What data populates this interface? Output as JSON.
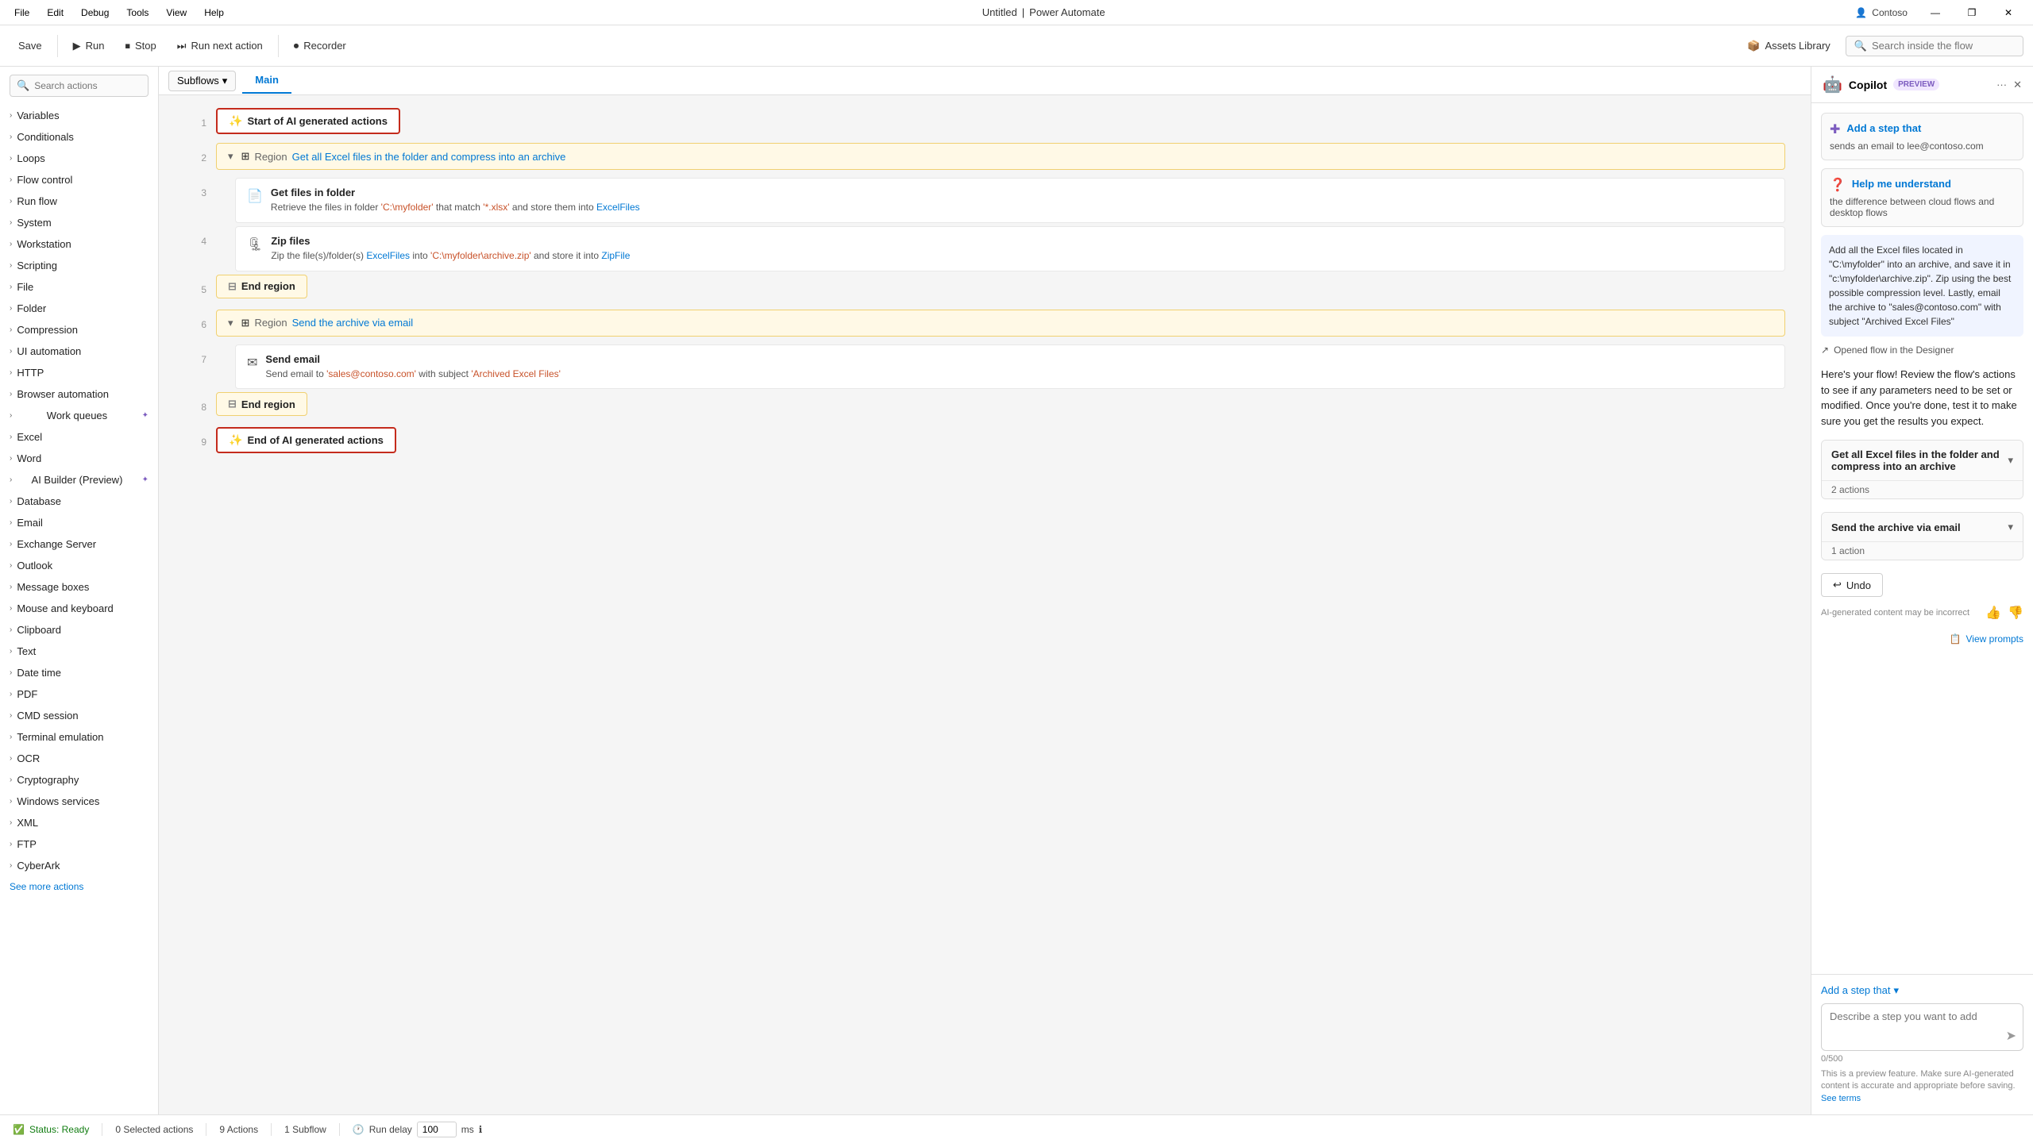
{
  "titleBar": {
    "menus": [
      "File",
      "Edit",
      "Debug",
      "Tools",
      "View",
      "Help"
    ],
    "appName": "Untitled",
    "appSuite": "Power Automate",
    "company": "Contoso",
    "winControls": [
      "—",
      "❐",
      "✕"
    ]
  },
  "toolbar": {
    "save": "Save",
    "run": "Run",
    "stop": "Stop",
    "runNextAction": "Run next action",
    "recorder": "Recorder",
    "assetsLibrary": "Assets Library",
    "searchInside": "Search inside the flow"
  },
  "sidebar": {
    "searchPlaceholder": "Search actions",
    "items": [
      {
        "label": "Variables",
        "hasBadge": false
      },
      {
        "label": "Conditionals",
        "hasBadge": false
      },
      {
        "label": "Loops",
        "hasBadge": false
      },
      {
        "label": "Flow control",
        "hasBadge": false
      },
      {
        "label": "Run flow",
        "hasBadge": false
      },
      {
        "label": "System",
        "hasBadge": false
      },
      {
        "label": "Workstation",
        "hasBadge": false
      },
      {
        "label": "Scripting",
        "hasBadge": false
      },
      {
        "label": "File",
        "hasBadge": false
      },
      {
        "label": "Folder",
        "hasBadge": false
      },
      {
        "label": "Compression",
        "hasBadge": false
      },
      {
        "label": "UI automation",
        "hasBadge": false
      },
      {
        "label": "HTTP",
        "hasBadge": false
      },
      {
        "label": "Browser automation",
        "hasBadge": false
      },
      {
        "label": "Work queues",
        "hasBadge": true
      },
      {
        "label": "Excel",
        "hasBadge": false
      },
      {
        "label": "Word",
        "hasBadge": false
      },
      {
        "label": "AI Builder (Preview)",
        "hasBadge": true
      },
      {
        "label": "Database",
        "hasBadge": false
      },
      {
        "label": "Email",
        "hasBadge": false
      },
      {
        "label": "Exchange Server",
        "hasBadge": false
      },
      {
        "label": "Outlook",
        "hasBadge": false
      },
      {
        "label": "Message boxes",
        "hasBadge": false
      },
      {
        "label": "Mouse and keyboard",
        "hasBadge": false
      },
      {
        "label": "Clipboard",
        "hasBadge": false
      },
      {
        "label": "Text",
        "hasBadge": false
      },
      {
        "label": "Date time",
        "hasBadge": false
      },
      {
        "label": "PDF",
        "hasBadge": false
      },
      {
        "label": "CMD session",
        "hasBadge": false
      },
      {
        "label": "Terminal emulation",
        "hasBadge": false
      },
      {
        "label": "OCR",
        "hasBadge": false
      },
      {
        "label": "Cryptography",
        "hasBadge": false
      },
      {
        "label": "Windows services",
        "hasBadge": false
      },
      {
        "label": "XML",
        "hasBadge": false
      },
      {
        "label": "FTP",
        "hasBadge": false
      },
      {
        "label": "CyberArk",
        "hasBadge": false
      }
    ],
    "seeMore": "See more actions"
  },
  "canvas": {
    "tabs": [
      "Main"
    ],
    "subflows": "Subflows",
    "rows": [
      {
        "number": 1,
        "type": "ai-boundary",
        "label": "Start of AI generated actions"
      },
      {
        "number": 2,
        "type": "region",
        "regionLabel": "Region",
        "regionName": "Get all Excel files in the folder and compress into an archive",
        "collapsed": false
      },
      {
        "number": 3,
        "type": "action",
        "indent": true,
        "icon": "📄",
        "title": "Get files in folder",
        "desc": "Retrieve the files in folder 'C:\\myfolder' that match '*.xlsx' and store them into",
        "highlight": "ExcelFiles"
      },
      {
        "number": 4,
        "type": "action",
        "indent": true,
        "icon": "🗜",
        "title": "Zip files",
        "descParts": [
          {
            "text": "Zip the file(s)/folder(s) "
          },
          {
            "text": "ExcelFiles",
            "type": "highlight"
          },
          {
            "text": " into "
          },
          {
            "text": "'C:\\myfolder\\archive.zip'",
            "type": "string"
          },
          {
            "text": " and store it into "
          },
          {
            "text": "ZipFile",
            "type": "highlight"
          }
        ]
      },
      {
        "number": 5,
        "type": "end-region",
        "label": "End region"
      },
      {
        "number": 6,
        "type": "region",
        "regionLabel": "Region",
        "regionName": "Send the archive via email",
        "collapsed": false
      },
      {
        "number": 7,
        "type": "action",
        "indent": true,
        "icon": "✉",
        "title": "Send email",
        "descParts": [
          {
            "text": "Send email to "
          },
          {
            "text": "'sales@contoso.com'",
            "type": "string"
          },
          {
            "text": " with subject "
          },
          {
            "text": "'Archived Excel Files'",
            "type": "string"
          }
        ]
      },
      {
        "number": 8,
        "type": "end-region",
        "label": "End region"
      },
      {
        "number": 9,
        "type": "ai-boundary",
        "label": "End of AI generated actions"
      }
    ]
  },
  "copilot": {
    "title": "Copilot",
    "preview": "PREVIEW",
    "suggestions": [
      {
        "icon": "✚",
        "title": "Add a step that",
        "desc": "sends an email to lee@contoso.com"
      },
      {
        "icon": "❓",
        "title": "Help me understand",
        "desc": "the difference between cloud flows and desktop flows"
      }
    ],
    "aiMessage": "Add all the Excel files located in \"C:\\myfolder\" into an archive, and save it in \"c:\\myfolder\\archive.zip\". Zip using the best possible compression level. Lastly, email the archive to \"sales@contoso.com\" with subject \"Archived Excel Files\"",
    "flowOpenedLabel": "Opened flow in the Designer",
    "hereFlowText": "Here's your flow! Review the flow's actions to see if any parameters need to be set or modified. Once you're done, test it to make sure you get the results you expect.",
    "actionGroups": [
      {
        "title": "Get all Excel files in the folder and compress into an archive",
        "count": "2 actions"
      },
      {
        "title": "Send the archive via email",
        "count": "1 action"
      }
    ],
    "undoLabel": "Undo",
    "disclaimer": "AI-generated content may be incorrect",
    "viewPrompts": "View prompts",
    "addStepLabel": "Add a step that",
    "inputPlaceholder": "Describe a step you want to add",
    "charCount": "0/500",
    "previewNotice": "This is a preview feature. Make sure AI-generated content is accurate and appropriate before saving.",
    "seeTerms": "See terms"
  },
  "statusBar": {
    "status": "Status: Ready",
    "selectedActions": "0 Selected actions",
    "totalActions": "9 Actions",
    "subflows": "1 Subflow",
    "runDelayLabel": "Run delay",
    "runDelayValue": "100",
    "runDelayUnit": "ms"
  }
}
